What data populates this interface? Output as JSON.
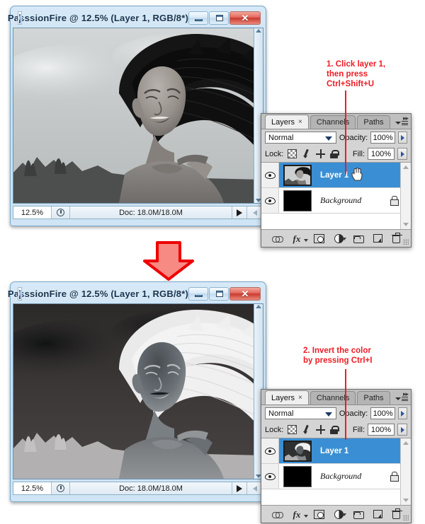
{
  "windows": [
    {
      "title": "PasssionFire @ 12.5% (Layer 1, RGB/8*)",
      "app_icon": "photoshop-document-icon",
      "controls": {
        "minimize": "minimize-icon",
        "maximize": "maximize-icon",
        "close": "✕"
      },
      "status": {
        "zoom": "12.5%",
        "doc": "Doc: 18.0M/18.0M",
        "timing_icon": "clock-icon",
        "play_icon": "play-arrow-icon",
        "back_icon": "left-arrow-icon"
      },
      "image_state": "grayscale"
    },
    {
      "title": "PasssionFire @ 12.5% (Layer 1, RGB/8*)",
      "app_icon": "photoshop-document-icon",
      "controls": {
        "minimize": "minimize-icon",
        "maximize": "maximize-icon",
        "close": "✕"
      },
      "status": {
        "zoom": "12.5%",
        "doc": "Doc: 18.0M/18.0M",
        "timing_icon": "clock-icon",
        "play_icon": "play-arrow-icon",
        "back_icon": "left-arrow-icon"
      },
      "image_state": "inverted"
    }
  ],
  "layers_panels": [
    {
      "tabs": [
        {
          "label": "Layers",
          "active": true,
          "close": "×"
        },
        {
          "label": "Channels",
          "active": false
        },
        {
          "label": "Paths",
          "active": false
        }
      ],
      "blend_mode": "Normal",
      "opacity_label": "Opacity:",
      "opacity_value": "100%",
      "lock_label": "Lock:",
      "lock_icons": [
        "lock-transparency-icon",
        "lock-image-icon",
        "lock-position-icon",
        "lock-all-icon"
      ],
      "fill_label": "Fill:",
      "fill_value": "100%",
      "layers": [
        {
          "name": "Layer 1",
          "selected": true,
          "visible": true,
          "locked": false,
          "thumb": "photo-grayscale"
        },
        {
          "name": "Background",
          "selected": false,
          "visible": true,
          "locked": true,
          "thumb": "black"
        }
      ],
      "footer_icons": [
        "link-layers-icon",
        "layer-style-fx-icon",
        "add-layer-mask-icon",
        "new-adjustment-layer-icon",
        "new-group-icon",
        "new-layer-icon",
        "delete-layer-icon"
      ]
    },
    {
      "tabs": [
        {
          "label": "Layers",
          "active": true,
          "close": "×"
        },
        {
          "label": "Channels",
          "active": false
        },
        {
          "label": "Paths",
          "active": false
        }
      ],
      "blend_mode": "Normal",
      "opacity_label": "Opacity:",
      "opacity_value": "100%",
      "lock_label": "Lock:",
      "lock_icons": [
        "lock-transparency-icon",
        "lock-image-icon",
        "lock-position-icon",
        "lock-all-icon"
      ],
      "fill_label": "Fill:",
      "fill_value": "100%",
      "layers": [
        {
          "name": "Layer 1",
          "selected": true,
          "visible": true,
          "locked": false,
          "thumb": "photo-inverted"
        },
        {
          "name": "Background",
          "selected": false,
          "visible": true,
          "locked": true,
          "thumb": "black"
        }
      ],
      "footer_icons": [
        "link-layers-icon",
        "layer-style-fx-icon",
        "add-layer-mask-icon",
        "new-adjustment-layer-icon",
        "new-group-icon",
        "new-layer-icon",
        "delete-layer-icon"
      ]
    }
  ],
  "annotations": [
    {
      "text": "1. Click layer 1,\nthen press\nCtrl+Shift+U",
      "color": "#ee1c25"
    },
    {
      "text": "2. Invert the color\nby pressing Ctrl+I",
      "color": "#ee1c25"
    }
  ],
  "flow_arrow": {
    "name": "down-arrow",
    "fill": "#f78a82",
    "stroke": "#ee0000"
  },
  "colors": {
    "accent_red": "#ee1c25",
    "selection_blue": "#3a8fd4",
    "titlebar_blue": "#c3ddf1",
    "panel_gray": "#d4d4d4"
  }
}
